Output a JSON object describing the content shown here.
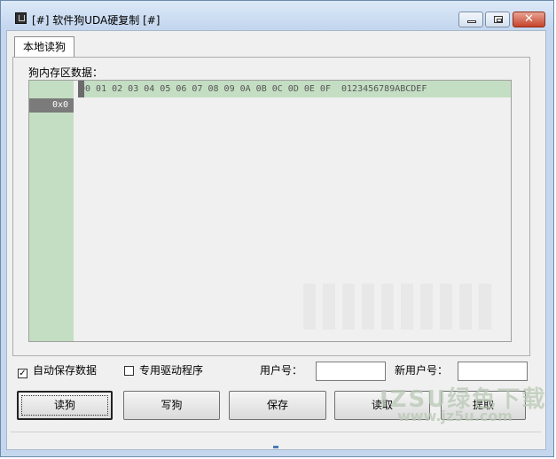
{
  "window": {
    "title": "[#] 软件狗UDA硬复制 [#]",
    "close_glyph": "✕"
  },
  "tabs": [
    {
      "label": "本地读狗"
    }
  ],
  "memory": {
    "section_label": "狗内存区数据：",
    "column_header": "00 01 02 03 04 05 06 07 08 09 0A 0B 0C 0D 0E 0F  0123456789ABCDEF",
    "rows": [
      {
        "label": "0x0"
      }
    ]
  },
  "options": {
    "auto_save_label": "自动保存数据",
    "auto_save_checked": true,
    "auto_save_mark": "✓",
    "driver_label": "专用驱动程序",
    "driver_checked": false,
    "driver_mark": ""
  },
  "fields": {
    "user_id_label": "用户号：",
    "user_id_value": "",
    "new_user_id_label": "新用户号：",
    "new_user_id_value": ""
  },
  "buttons": {
    "read": "读狗",
    "write": "写狗",
    "save": "保存",
    "load": "读取",
    "extract": "提取"
  },
  "watermark": {
    "line1": "IZSU绿色下载",
    "line2": "www.jz5u.com"
  },
  "colors": {
    "grid_header": "#c4dec4",
    "row_label_bg": "#7b7b7b"
  }
}
